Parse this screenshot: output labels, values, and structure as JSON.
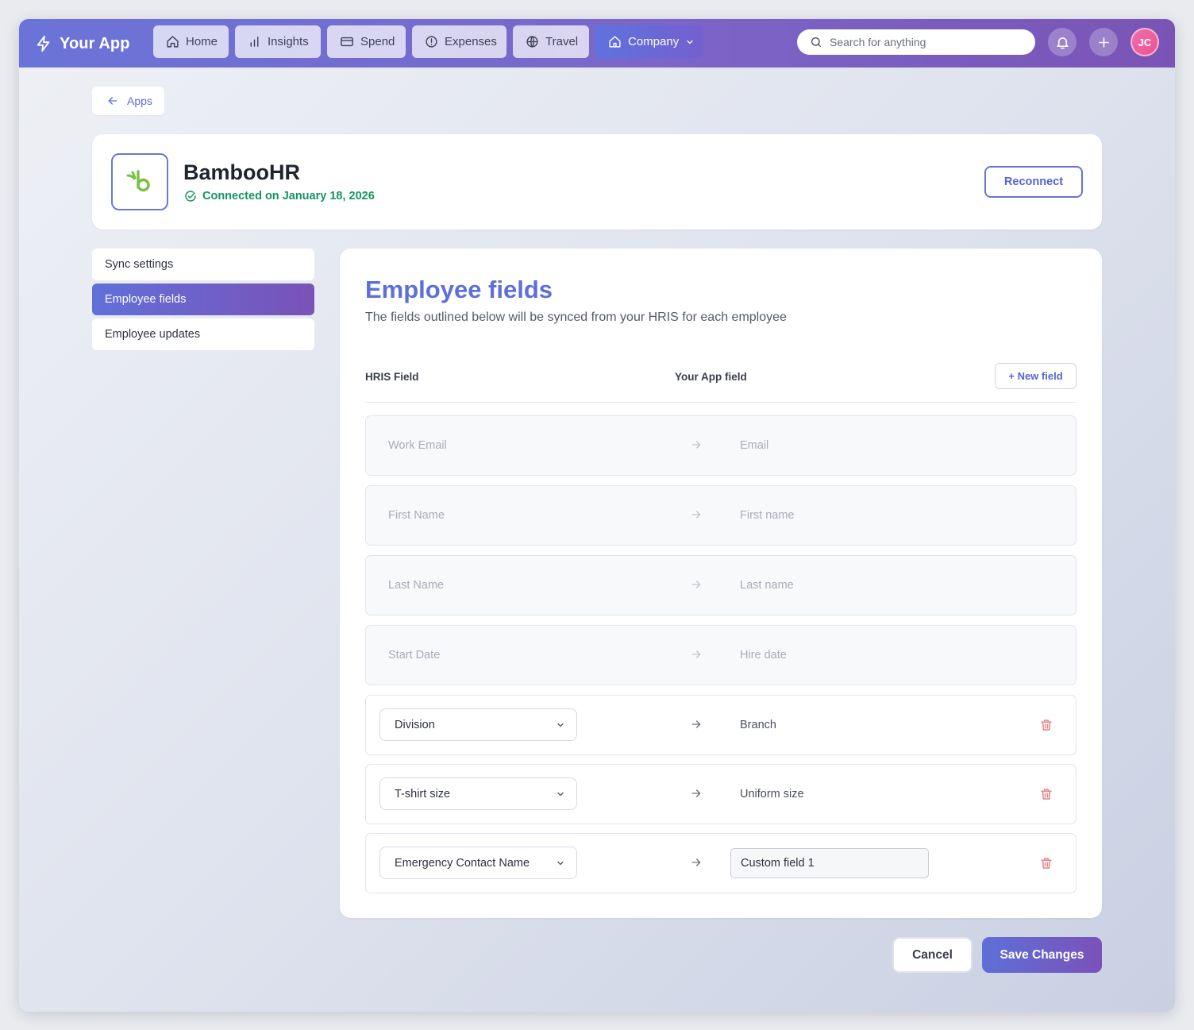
{
  "app": {
    "title": "Your App",
    "bolt_icon": "bolt-icon"
  },
  "nav": {
    "home": "Home",
    "insights": "Insights",
    "spend": "Spend",
    "expenses": "Expenses",
    "travel": "Travel",
    "company": "Company"
  },
  "search": {
    "placeholder": "Search for anything"
  },
  "user": {
    "initials": "JC"
  },
  "back": {
    "label": "Apps"
  },
  "integration": {
    "name": "BambooHR",
    "status": "Connected on January 18, 2026",
    "reconnect_label": "Reconnect",
    "status_color": "#13955f"
  },
  "sidebar": {
    "items": [
      {
        "label": "Sync settings",
        "active": false
      },
      {
        "label": "Employee fields",
        "active": true
      },
      {
        "label": "Employee updates",
        "active": false
      }
    ]
  },
  "main": {
    "title": "Employee fields",
    "subtitle": "The fields outlined below will be synced from your HRIS for each employee",
    "col_hris": "HRIS Field",
    "col_app": "Your App field",
    "new_field_label": "+ New field",
    "locked_rows": [
      {
        "hris": "Work Email",
        "app": "Email"
      },
      {
        "hris": "First Name",
        "app": "First name"
      },
      {
        "hris": "Last Name",
        "app": "Last name"
      },
      {
        "hris": "Start Date",
        "app": "Hire date"
      }
    ],
    "custom_rows": [
      {
        "hris": "Division",
        "app": "Branch"
      },
      {
        "hris": "T-shirt size",
        "app": "Uniform size"
      },
      {
        "hris": "Emergency Contact Name",
        "app_input": "Custom field 1"
      }
    ]
  },
  "footer": {
    "cancel_label": "Cancel",
    "save_label": "Save Changes"
  },
  "colors": {
    "accent": "#5e6fd8",
    "accent_purple": "#7a52b8",
    "danger": "#e5848a"
  }
}
